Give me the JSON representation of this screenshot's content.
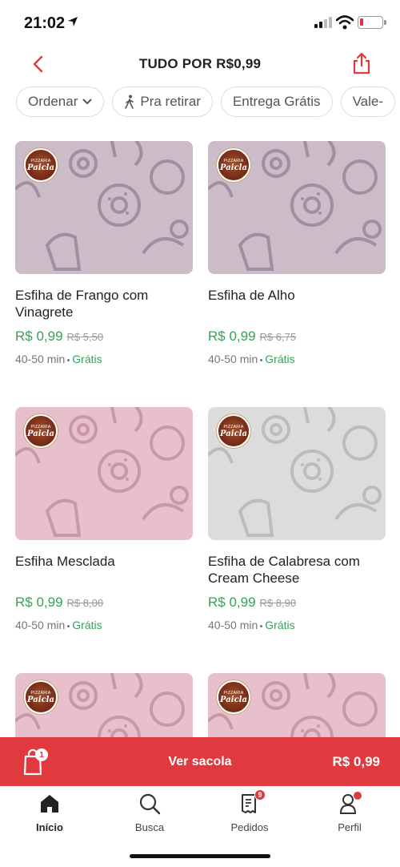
{
  "status_bar": {
    "time": "21:02"
  },
  "header": {
    "title": "TUDO POR R$0,99"
  },
  "filters": [
    {
      "label": "Ordenar",
      "icon": "chevron-down-icon"
    },
    {
      "label": "Pra retirar",
      "icon": "walking-icon"
    },
    {
      "label": "Entrega Grátis"
    },
    {
      "label": "Vale-"
    }
  ],
  "products": [
    {
      "name": "Esfiha de Frango com Vinagrete",
      "price": "R$ 0,99",
      "old_price": "R$ 5,50",
      "time": "40-50 min",
      "delivery": "Grátis",
      "bg_color": "#cbbcc8",
      "pattern_color": "#a48da0",
      "logo": "Paicla"
    },
    {
      "name": "Esfiha de Alho",
      "price": "R$ 0,99",
      "old_price": "R$ 6,75",
      "time": "40-50 min",
      "delivery": "Grátis",
      "bg_color": "#cbbcc8",
      "pattern_color": "#a48da0",
      "logo": "Paicla"
    },
    {
      "name": "Esfiha Mesclada",
      "price": "R$ 0,99",
      "old_price": "R$ 8,00",
      "time": "40-50 min",
      "delivery": "Grátis",
      "bg_color": "#e8c0cb",
      "pattern_color": "#c898a6",
      "logo": "Paicla"
    },
    {
      "name": "Esfiha de Calabresa com Cream Cheese",
      "price": "R$ 0,99",
      "old_price": "R$ 8,90",
      "time": "40-50 min",
      "delivery": "Grátis",
      "bg_color": "#dcdcdc",
      "pattern_color": "#bcbcbc",
      "logo": "Paicla"
    },
    {
      "name": "",
      "price": "",
      "old_price": "",
      "time": "",
      "delivery": "",
      "bg_color": "#e8c0cb",
      "pattern_color": "#c898a6",
      "logo": "Paicla"
    },
    {
      "name": "",
      "price": "",
      "old_price": "",
      "time": "",
      "delivery": "",
      "bg_color": "#e8c0cb",
      "pattern_color": "#c898a6",
      "logo": "Paicla"
    }
  ],
  "bag": {
    "count": "1",
    "label": "Ver sacola",
    "total": "R$ 0,99"
  },
  "tabs": [
    {
      "label": "Início",
      "icon": "home-icon",
      "active": true
    },
    {
      "label": "Busca",
      "icon": "search-icon"
    },
    {
      "label": "Pedidos",
      "icon": "receipt-icon",
      "badge": "9"
    },
    {
      "label": "Perfil",
      "icon": "user-icon",
      "dot": true
    }
  ],
  "colors": {
    "accent": "#e03a3e",
    "price_green": "#3aa05a"
  }
}
